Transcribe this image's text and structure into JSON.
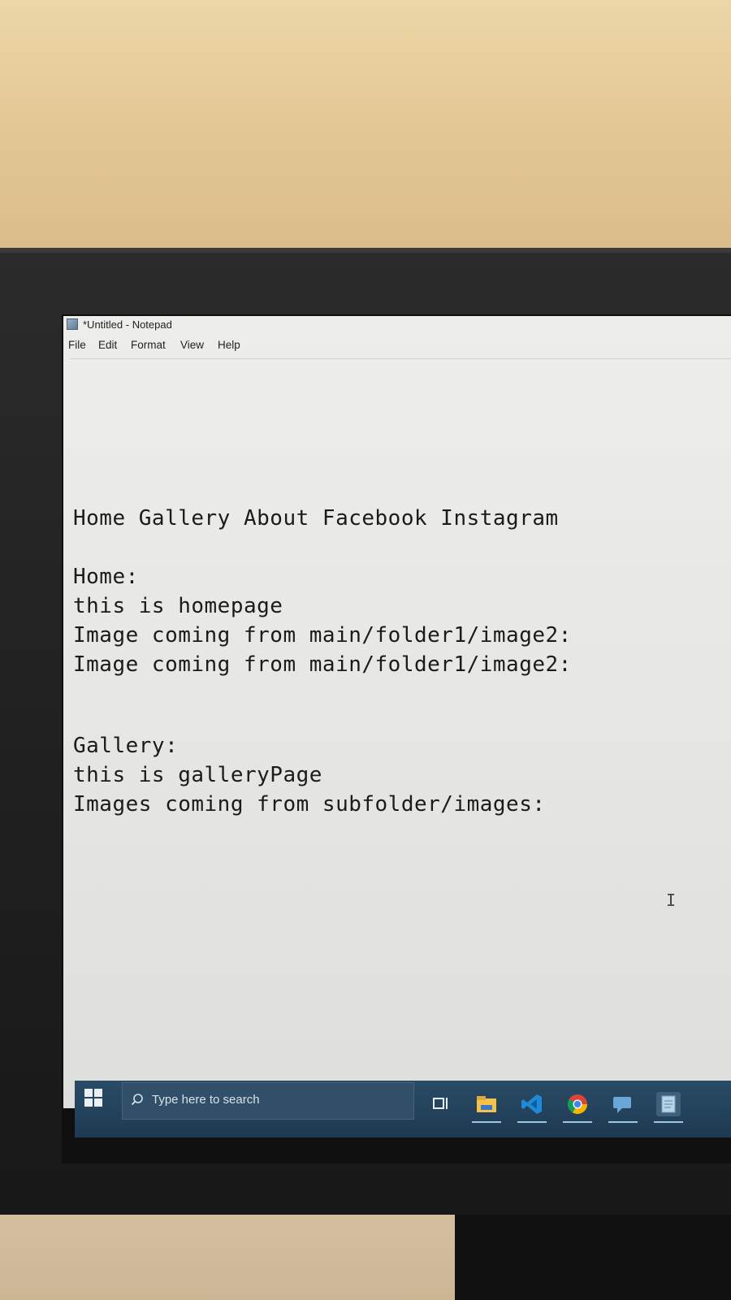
{
  "window": {
    "title": "*Untitled - Notepad"
  },
  "menu": [
    {
      "label": "File"
    },
    {
      "label": "Edit"
    },
    {
      "label": "Format"
    },
    {
      "label": "View"
    },
    {
      "label": "Help"
    }
  ],
  "editor": {
    "lines": [
      "Home Gallery About Facebook Instagram",
      "Home:",
      "this is homepage",
      "Image coming from main/folder1/image2:",
      "Image coming from main/folder1/image2:",
      "Gallery:",
      "this is galleryPage",
      "Images coming from subfolder/images:"
    ]
  },
  "taskbar": {
    "search_placeholder": "Type here to search",
    "icons": [
      "windows-start-icon",
      "task-view-icon",
      "file-explorer-icon",
      "vscode-icon",
      "chrome-icon",
      "feedback-icon",
      "notepad-icon"
    ]
  }
}
